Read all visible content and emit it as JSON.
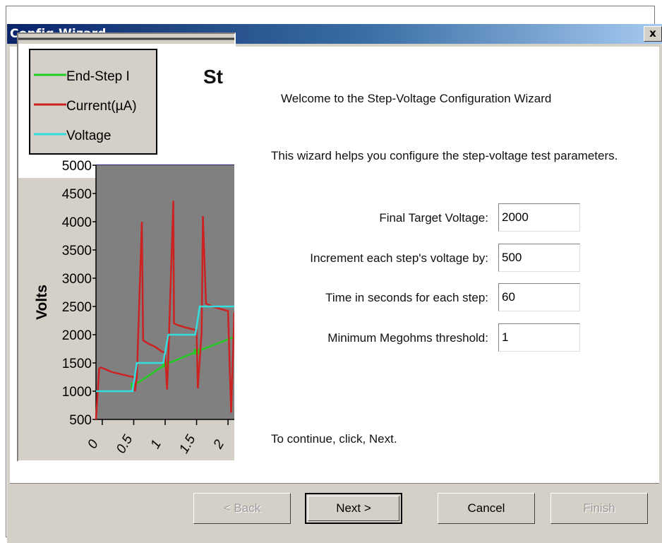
{
  "window": {
    "title": "Config Wizard",
    "close_glyph": "x"
  },
  "chart_data": {
    "type": "line",
    "title": "St",
    "ylabel": "Volts",
    "ylim": [
      500,
      5000
    ],
    "yticks": [
      "500",
      "1000",
      "1500",
      "2000",
      "2500",
      "3000",
      "3500",
      "4000",
      "4500",
      "5000"
    ],
    "xticks": [
      "0",
      "0.5",
      "1",
      "1.5",
      "2"
    ],
    "xlim": [
      -0.1,
      2.1
    ],
    "legend_position": "top-left",
    "legend": [
      {
        "name": "End-Step I",
        "color": "#22cc22"
      },
      {
        "name": "Current(µA)",
        "color": "#cc2222"
      },
      {
        "name": "Voltage",
        "color": "#33dddd"
      }
    ],
    "series": [
      {
        "name": "End-Step I",
        "color": "#22cc22",
        "x": [
          0.5,
          1.0,
          1.5,
          2.1
        ],
        "y": [
          1100,
          1470,
          1700,
          1960
        ]
      },
      {
        "name": "Current(µA)",
        "color": "#cc2222",
        "x": [
          -0.1,
          -0.05,
          -0.02,
          0.15,
          0.45,
          0.5,
          0.52,
          0.55,
          0.63,
          0.65,
          0.72,
          0.85,
          0.95,
          1.0,
          1.03,
          1.05,
          1.13,
          1.14,
          1.2,
          1.35,
          1.5,
          1.52,
          1.58,
          1.6,
          1.65,
          1.75,
          1.9,
          2.0,
          2.05,
          2.1
        ],
        "y": [
          500,
          1400,
          1420,
          1340,
          1260,
          1250,
          1000,
          1250,
          4000,
          1900,
          1850,
          1780,
          1700,
          1680,
          1030,
          1600,
          4370,
          2200,
          2170,
          2120,
          2080,
          1050,
          2050,
          4100,
          2550,
          2500,
          2450,
          2420,
          620,
          2400
        ]
      },
      {
        "name": "Voltage",
        "color": "#33dddd",
        "x": [
          -0.1,
          0.48,
          0.55,
          0.97,
          1.05,
          1.48,
          1.55,
          2.1
        ],
        "y": [
          1000,
          1000,
          1500,
          1500,
          2000,
          2000,
          2500,
          2500
        ]
      }
    ]
  },
  "welcome_text": "Welcome to the Step-Voltage Configuration Wizard",
  "description_text": "This wizard helps you configure the step-voltage test parameters.",
  "fields": [
    {
      "label": "Final Target Voltage:",
      "value": "2000"
    },
    {
      "label": "Increment each step's voltage by:",
      "value": "500"
    },
    {
      "label": "Time in seconds for each step:",
      "value": "60"
    },
    {
      "label": "Minimum Megohms threshold:",
      "value": "1"
    }
  ],
  "continue_text": "To continue, click, Next.",
  "buttons": {
    "back": "< Back",
    "next": "Next >",
    "cancel": "Cancel",
    "finish": "Finish"
  },
  "colors": {
    "titlebar_start": "#0a246a",
    "titlebar_end": "#a6caf0",
    "plot_background": "#808080",
    "dialog_face": "#d4d0c8"
  }
}
